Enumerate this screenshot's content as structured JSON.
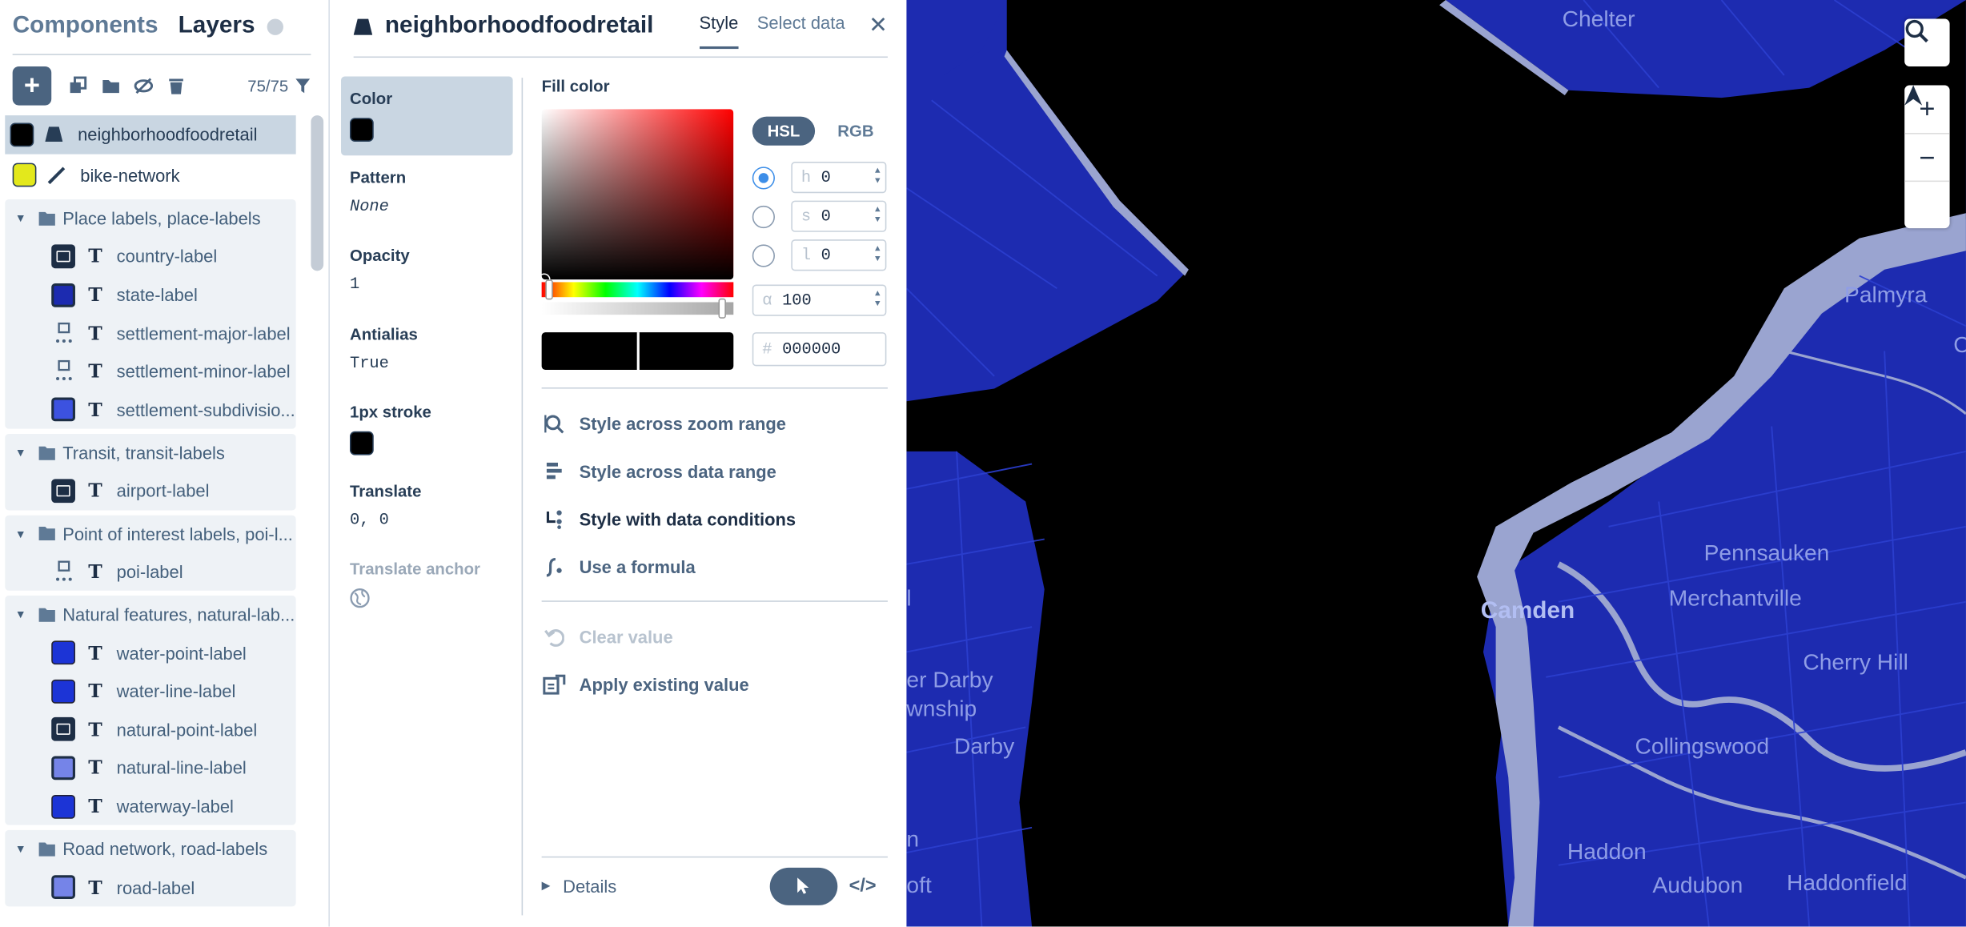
{
  "layers_panel": {
    "tab_components": "Components",
    "tab_layers": "Layers",
    "count": "75/75",
    "top_layers": [
      {
        "name": "neighborhoodfoodretail",
        "swatch": "#000000",
        "selected": true
      },
      {
        "name": "bike-network",
        "swatch": "#e3e81c",
        "selected": false
      }
    ],
    "groups": [
      {
        "title": "Place labels, place-labels",
        "items": [
          {
            "name": "country-label",
            "icon": "icon-square"
          },
          {
            "name": "state-label",
            "icon": "navy-square"
          },
          {
            "name": "settlement-major-label",
            "icon": "dotted-icon"
          },
          {
            "name": "settlement-minor-label",
            "icon": "dotted-icon"
          },
          {
            "name": "settlement-subdivisio...",
            "icon": "blue-square"
          }
        ]
      },
      {
        "title": "Transit, transit-labels",
        "items": [
          {
            "name": "airport-label",
            "icon": "icon-square"
          }
        ]
      },
      {
        "title": "Point of interest labels, poi-l...",
        "items": [
          {
            "name": "poi-label",
            "icon": "dotted-icon"
          }
        ]
      },
      {
        "title": "Natural features, natural-lab...",
        "items": [
          {
            "name": "water-point-label",
            "icon": "blue-square"
          },
          {
            "name": "water-line-label",
            "icon": "blue-square"
          },
          {
            "name": "natural-point-label",
            "icon": "icon-square"
          },
          {
            "name": "natural-line-label",
            "icon": "lavender-square"
          },
          {
            "name": "waterway-label",
            "icon": "blue-square"
          }
        ]
      },
      {
        "title": "Road network, road-labels",
        "items": [
          {
            "name": "road-label",
            "icon": "lavender-square"
          }
        ]
      }
    ]
  },
  "style_panel": {
    "layer_name": "neighborhoodfoodretail",
    "tab_style": "Style",
    "tab_select_data": "Select data",
    "properties": {
      "color": {
        "label": "Color",
        "value": "#000000"
      },
      "pattern": {
        "label": "Pattern",
        "value": "None"
      },
      "opacity": {
        "label": "Opacity",
        "value": "1"
      },
      "antialias": {
        "label": "Antialias",
        "value": "True"
      },
      "stroke": {
        "label": "1px stroke",
        "value": "#000000"
      },
      "translate": {
        "label": "Translate",
        "value": "0, 0"
      },
      "translate_anchor": {
        "label": "Translate anchor"
      }
    },
    "fill_color": {
      "title": "Fill color",
      "mode_hsl": "HSL",
      "mode_rgb": "RGB",
      "h_key": "h",
      "h": "0",
      "s_key": "s",
      "s": "0",
      "l_key": "l",
      "l": "0",
      "alpha_key": "α",
      "alpha": "100",
      "hex_key": "#",
      "hex": "000000"
    },
    "actions": {
      "zoom_range": "Style across zoom range",
      "data_range": "Style across data range",
      "data_conditions": "Style with data conditions",
      "formula": "Use a formula",
      "clear": "Clear value",
      "apply_existing": "Apply existing value"
    },
    "details": "Details"
  },
  "map": {
    "labels": {
      "chelten": "Chelter",
      "palmyra": "Palmyra",
      "pennsauken": "Pennsauken",
      "merchantville": "Merchantville",
      "camden": "Camden",
      "cherry_hill": "Cherry Hill",
      "collingswood": "Collingswood",
      "darby_upper": "er Darby",
      "township": "wnship",
      "darby": "Darby",
      "haddon": "Haddon",
      "audubon": "Audubon",
      "haddonfield": "Haddonfield",
      "left_l": "l",
      "left_n": "n",
      "left_oft": "oft",
      "right_c": "C"
    },
    "colors": {
      "water": "#000000",
      "land": "#1d2bb0",
      "river_edge": "#9aa4d0"
    }
  }
}
